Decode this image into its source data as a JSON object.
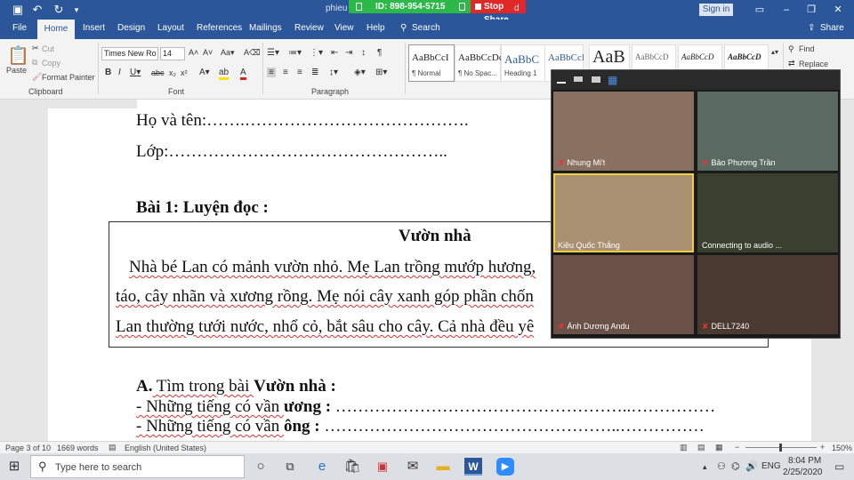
{
  "titlebar": {
    "doc_title": "phieu h",
    "doc_suffix": "d",
    "zoom_meeting_id": "ID: 898-954-5715",
    "stop_share": "Stop Share",
    "sign_in": "Sign in",
    "share": "Share",
    "search": "Search",
    "bg_color": "#2b579a"
  },
  "tabs": [
    "File",
    "Home",
    "Insert",
    "Design",
    "Layout",
    "References",
    "Mailings",
    "Review",
    "View",
    "Help"
  ],
  "ribbon": {
    "clipboard": {
      "paste": "Paste",
      "cut": "Cut",
      "copy": "Copy",
      "format_painter": "Format Painter",
      "group": "Clipboard"
    },
    "font": {
      "font_name": "Times New Ro",
      "font_size": "14",
      "group": "Font"
    },
    "paragraph": {
      "group": "Paragraph"
    },
    "styles": [
      {
        "preview": "AaBbCcI",
        "name": "¶ Normal"
      },
      {
        "preview": "AaBbCcDc",
        "name": "¶ No Spac..."
      },
      {
        "preview": "AaBbC",
        "name": "Heading 1"
      },
      {
        "preview": "AaBbCcI",
        "name": ""
      },
      {
        "preview": "AaB",
        "name": ""
      },
      {
        "preview": "AaBbCcD",
        "name": ""
      },
      {
        "preview": "AaBbCcD",
        "name": ""
      },
      {
        "preview": "AaBbCcD",
        "name": ""
      }
    ],
    "editing": {
      "find": "Find",
      "replace": "Replace"
    }
  },
  "document": {
    "name_line": "Họ và tên:…….………………………………….",
    "class_line": "Lớp:…………………………………………..",
    "exercise_title": "Bài 1: Luyện đọc :",
    "passage_title": "Vườn nhà",
    "passage_lines": [
      "Nhà bé Lan có mảnh vườn nhỏ. Mẹ Lan trồng mướp hương,",
      "táo, cây nhãn và xương rồng. Mẹ nói cây xanh góp phần chốn",
      "Lan thường tưới nước, nhổ cỏ, bắt sâu cho cây. Cả nhà đều yê"
    ],
    "task_a_prefix": "A.",
    "task_a_text": " Tìm trong bài ",
    "task_a_bold": "Vườn nhà :",
    "task_line_1_prefix": "- Những tiếng có vần ",
    "task_line_1_bold": "ương :",
    "task_line_1_dots": " ……………………………………………..……………",
    "task_line_2_prefix": "- Những tiếng có vần ",
    "task_line_2_bold": "ông :",
    "task_line_2_dots": " ……………………………………………..……………"
  },
  "zoom_participants": [
    {
      "name": "Nhung Mi't",
      "bg": "#8a7060"
    },
    {
      "name": "Bảo Phương Trần",
      "bg": "#5a6a60"
    },
    {
      "name": "Kiều Quốc Thắng",
      "bg": "#a89070"
    },
    {
      "name": "Connecting to audio ...",
      "bg": "#3a4030"
    },
    {
      "name": "Ánh Dương Andu",
      "bg": "#6a5248"
    },
    {
      "name": "DELL7240",
      "bg": "#4a3a30"
    }
  ],
  "statusbar": {
    "page": "Page 3 of 10",
    "words": "1669 words",
    "language": "English (United States)",
    "zoom": "150%"
  },
  "taskbar": {
    "search_placeholder": "Type here to search",
    "lang": "ENG",
    "time": "8:04 PM",
    "date": "2/25/2020"
  }
}
